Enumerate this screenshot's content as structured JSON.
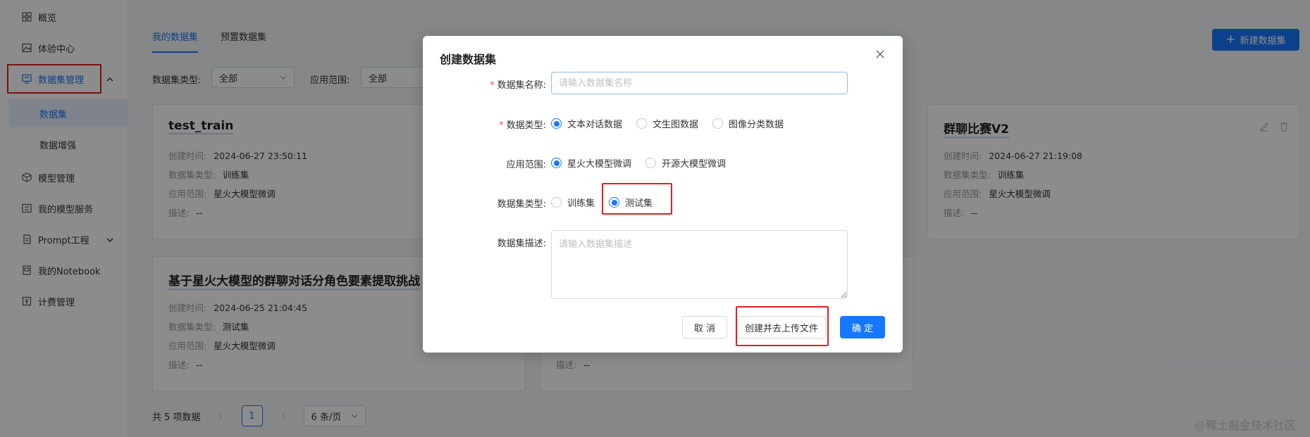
{
  "sidebar": {
    "items": [
      {
        "label": "概览",
        "icon": "dashboard-icon"
      },
      {
        "label": "体验中心",
        "icon": "image-icon"
      },
      {
        "label": "数据集管理",
        "icon": "dataset-icon"
      },
      {
        "label": "模型管理",
        "icon": "cube-icon"
      },
      {
        "label": "我的模型服务",
        "icon": "server-icon"
      },
      {
        "label": "Prompt工程",
        "icon": "prompt-icon"
      },
      {
        "label": "我的Notebook",
        "icon": "notebook-icon"
      },
      {
        "label": "计费管理",
        "icon": "billing-icon"
      }
    ],
    "sub": [
      {
        "label": "数据集"
      },
      {
        "label": "数据增强"
      }
    ]
  },
  "tabs": [
    {
      "label": "我的数据集"
    },
    {
      "label": "预置数据集"
    }
  ],
  "new_button": "新建数据集",
  "filters": {
    "type_label": "数据集类型:",
    "type_value": "全部",
    "scope_label": "应用范围:",
    "scope_value": "全部"
  },
  "cards": [
    {
      "title": "test_train",
      "created_label": "创建时间:",
      "created": "2024-06-27 23:50:11",
      "type_label": "数据集类型:",
      "type": "训练集",
      "scope_label": "应用范围:",
      "scope": "星火大模型微调",
      "desc_label": "描述:",
      "desc": "--"
    },
    {
      "title": "群聊比赛V2",
      "created_label": "创建时间:",
      "created": "2024-06-27 21:19:08",
      "type_label": "数据集类型:",
      "type": "训练集",
      "scope_label": "应用范围:",
      "scope": "星火大模型微调",
      "desc_label": "描述:",
      "desc": "--"
    },
    {
      "title": "基于星火大模型的群聊对话分角色要素提取挑战",
      "created_label": "创建时间:",
      "created": "2024-06-25 21:04:45",
      "type_label": "数据集类型:",
      "type": "测试集",
      "scope_label": "应用范围:",
      "scope": "星火大模型微调",
      "desc_label": "描述:",
      "desc": "--"
    },
    {
      "desc_label": "描述:",
      "desc": "--"
    }
  ],
  "pager": {
    "total": "共 5 项数据",
    "current": "1",
    "page_size": "6 条/页"
  },
  "watermark": "@稀土掘金技术社区",
  "modal": {
    "title": "创建数据集",
    "name_label": "数据集名称:",
    "name_placeholder": "请输入数据集名称",
    "data_type_label": "数据类型:",
    "data_type_options": [
      "文本对话数据",
      "文生图数据",
      "图像分类数据"
    ],
    "scope_label": "应用范围:",
    "scope_options": [
      "星火大模型微调",
      "开源大模型微调"
    ],
    "set_type_label": "数据集类型:",
    "set_type_options": [
      "训练集",
      "测试集"
    ],
    "desc_label": "数据集描述:",
    "desc_placeholder": "请输入数据集描述",
    "cancel": "取 消",
    "create_upload": "创建并去上传文件",
    "confirm": "确 定"
  },
  "colors": {
    "primary": "#1677ff",
    "highlight": "#e02020"
  }
}
